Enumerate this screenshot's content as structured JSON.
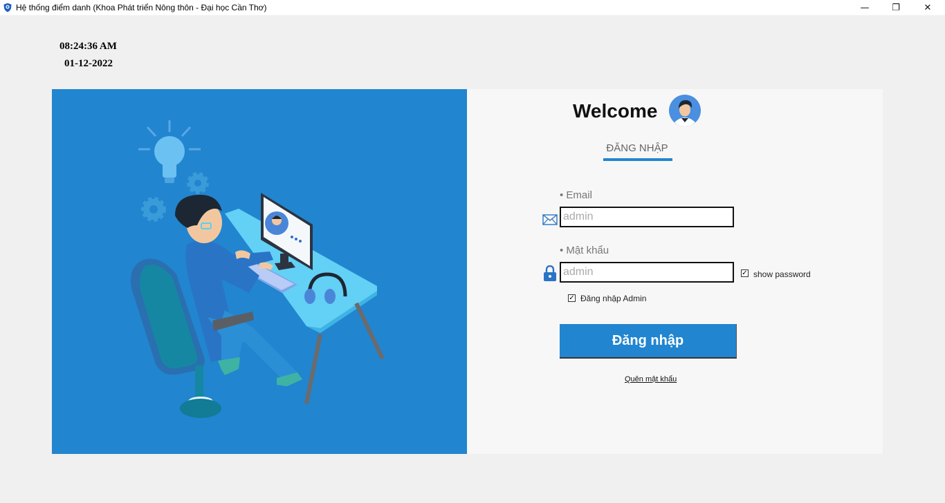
{
  "window": {
    "title": "Hệ thống điểm danh (Khoa Phát triển Nông thôn - Đại học Cần Thơ)",
    "minimize_glyph": "—",
    "maximize_glyph": "❐",
    "close_glyph": "✕"
  },
  "clock": {
    "time": "08:24:36 AM",
    "date": "01-12-2022"
  },
  "login": {
    "welcome": "Welcome",
    "tab_label": "ĐĂNG NHẬP",
    "email_label": "• Email",
    "email_value": "admin",
    "password_label": "• Mật khẩu",
    "password_value": "admin",
    "show_password_label": "show password",
    "show_password_checked": true,
    "admin_label": "Đăng nhập Admin",
    "admin_checked": true,
    "submit_label": "Đăng nhập",
    "forgot_label": "Quên mật khẩu",
    "check_glyph": "✓"
  },
  "colors": {
    "accent": "#2185d0",
    "panel_bg": "#f7f7f7",
    "window_bg": "#f0f0f0"
  },
  "icons": [
    "app-shield-icon",
    "mail-icon",
    "lock-icon",
    "user-avatar-icon",
    "lightbulb-icon",
    "gear-icon"
  ]
}
